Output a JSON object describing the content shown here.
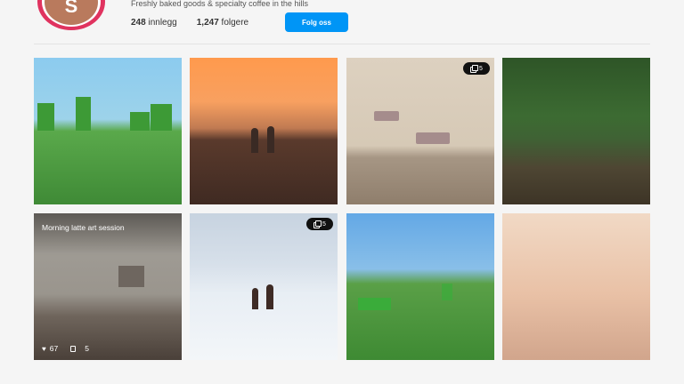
{
  "profile": {
    "avatar_letter": "S",
    "bio": "Freshly baked goods & specialty coffee in the hills",
    "stats": {
      "posts_count": "248",
      "posts_label": "innlegg",
      "followers_count": "1,247",
      "followers_label": "folgere"
    },
    "follow_button_label": "Folg oss"
  },
  "grid": {
    "tiles": [
      {
        "scene": "green-field-trees",
        "carousel": false
      },
      {
        "scene": "sunset-silhouettes",
        "carousel": false
      },
      {
        "scene": "beige-room",
        "carousel": true,
        "carousel_count": "5"
      },
      {
        "scene": "forest",
        "carousel": false
      },
      {
        "scene": "coffee",
        "carousel": false,
        "hover": true,
        "caption": "Morning latte art session",
        "likes": "67",
        "comments": "5"
      },
      {
        "scene": "snow-silhouettes",
        "carousel": true,
        "carousel_count": "5"
      },
      {
        "scene": "meadow",
        "carousel": false
      },
      {
        "scene": "peach-gradient",
        "carousel": false
      }
    ]
  },
  "colors": {
    "accent": "#0095f6",
    "avatar_ring": "#e0335f",
    "avatar_fill": "#b97a5d"
  },
  "icons": {
    "carousel": "stack-icon",
    "like": "heart-icon",
    "comment": "comment-icon"
  }
}
